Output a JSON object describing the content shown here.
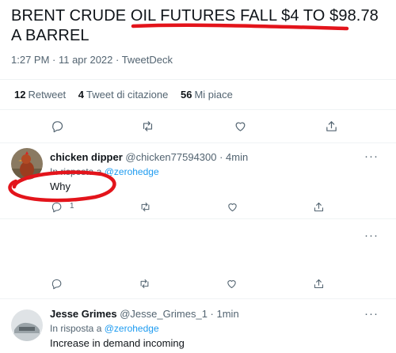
{
  "tweet": {
    "text": "BRENT CRUDE OIL FUTURES FALL $4 TO $98.78 A BARREL",
    "meta": "1:27 PM · 11 apr 2022 · TweetDeck",
    "stats": [
      {
        "count": "12",
        "label": "Retweet"
      },
      {
        "count": "4",
        "label": "Tweet di citazione"
      },
      {
        "count": "56",
        "label": "Mi piace"
      }
    ]
  },
  "replies": [
    {
      "name": "chicken dipper",
      "handle_time": "@chicken77594300 · 4min",
      "in_reply_prefix": "In risposta a",
      "in_reply_handle": "@zerohedge",
      "text": "Why",
      "reply_count": "1"
    },
    {
      "name": "Jesse Grimes",
      "handle_time": "@Jesse_Grimes_1 · 1min",
      "in_reply_prefix": "In risposta a",
      "in_reply_handle": "@zerohedge",
      "text": "Increase in demand incoming"
    }
  ],
  "more_label": "···",
  "icons": [
    "reply-icon",
    "retweet-icon",
    "like-icon",
    "share-icon",
    "more-icon"
  ],
  "colors": {
    "accent": "#1d9bf0",
    "annotation": "#e3141b",
    "muted": "#536471"
  }
}
